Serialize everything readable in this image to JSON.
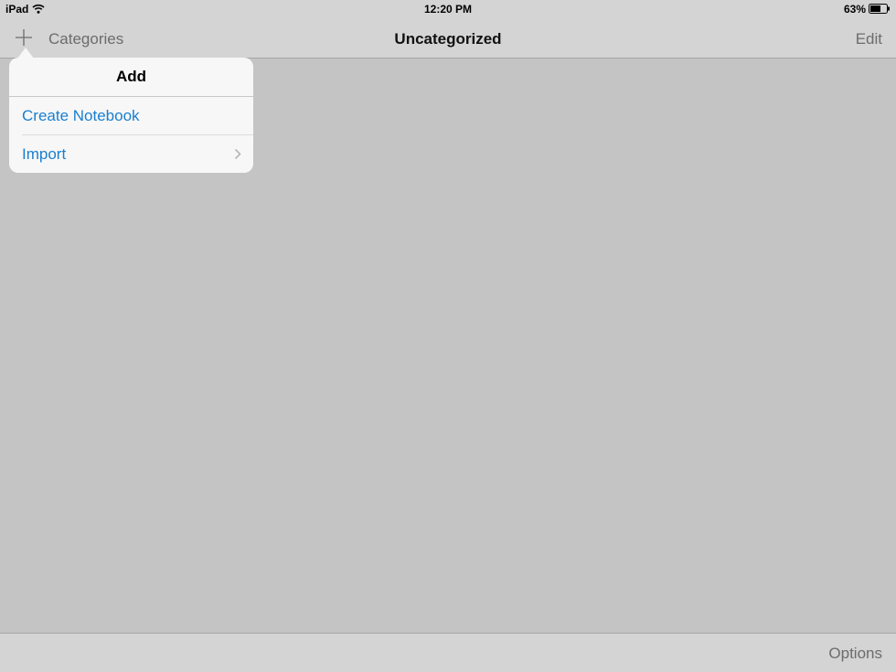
{
  "status_bar": {
    "device": "iPad",
    "time": "12:20 PM",
    "battery_percent": "63%",
    "icons": [
      "wifi-icon",
      "battery-icon"
    ]
  },
  "nav_bar": {
    "add_icon": "plus-icon",
    "back_label": "Categories",
    "title": "Uncategorized",
    "edit_label": "Edit"
  },
  "popover": {
    "title": "Add",
    "items": [
      {
        "label": "Create Notebook",
        "has_chevron": false
      },
      {
        "label": "Import",
        "has_chevron": true,
        "chevron_icon": "chevron-right-icon"
      }
    ]
  },
  "toolbar": {
    "options_label": "Options"
  },
  "colors": {
    "accent": "#1a7fcf",
    "background": "#c4c4c4",
    "bar": "#d4d4d4",
    "dimmed_text": "#6c6c6c"
  }
}
